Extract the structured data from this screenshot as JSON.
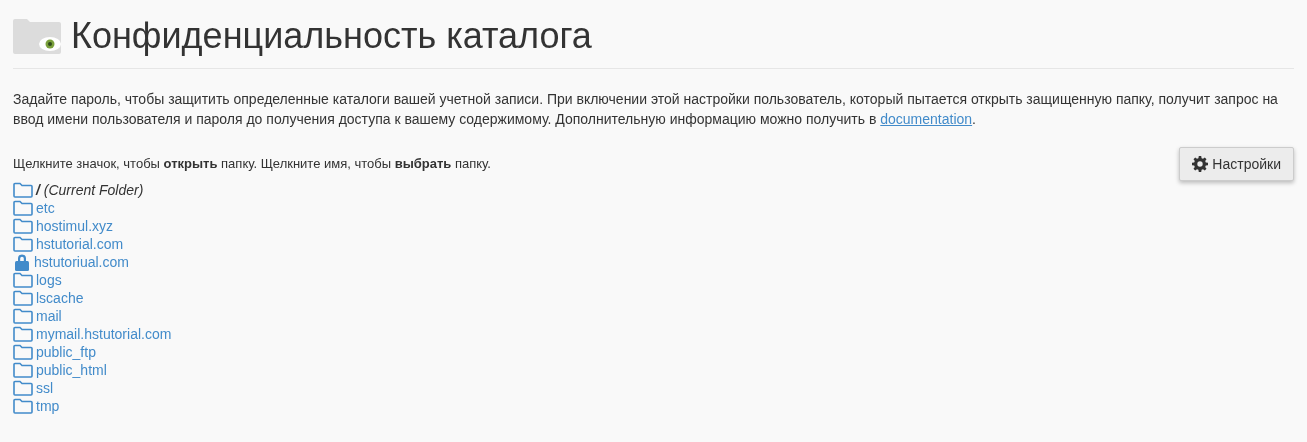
{
  "title": "Конфиденциальность каталога",
  "description": {
    "text": "Задайте пароль, чтобы защитить определенные каталоги вашей учетной записи. При включении этой настройки пользователь, который пытается открыть защищенную папку, получит запрос на ввод имени пользователя и пароля до получения доступа к вашему содержимому. Дополнительную информацию можно получить в",
    "link": "documentation",
    "after": "."
  },
  "instruction": "Щелкните значок, чтобы **открыть** папку. Щелкните имя, чтобы **выбрать** папку.",
  "settings_button": "Настройки",
  "folders": [
    {
      "kind": "current",
      "name": "/",
      "note": "(Current Folder)",
      "locked": false
    },
    {
      "kind": "folder",
      "name": "etc",
      "locked": false
    },
    {
      "kind": "folder",
      "name": "hostimul.xyz",
      "locked": false
    },
    {
      "kind": "folder",
      "name": "hstutorial.com",
      "locked": false
    },
    {
      "kind": "folder",
      "name": "hstutoriual.com",
      "locked": true
    },
    {
      "kind": "folder",
      "name": "logs",
      "locked": false
    },
    {
      "kind": "folder",
      "name": "lscache",
      "locked": false
    },
    {
      "kind": "folder",
      "name": "mail",
      "locked": false
    },
    {
      "kind": "folder",
      "name": "mymail.hstutorial.com",
      "locked": false
    },
    {
      "kind": "folder",
      "name": "public_ftp",
      "locked": false
    },
    {
      "kind": "folder",
      "name": "public_html",
      "locked": false
    },
    {
      "kind": "folder",
      "name": "ssl",
      "locked": false
    },
    {
      "kind": "folder",
      "name": "tmp",
      "locked": false
    }
  ]
}
